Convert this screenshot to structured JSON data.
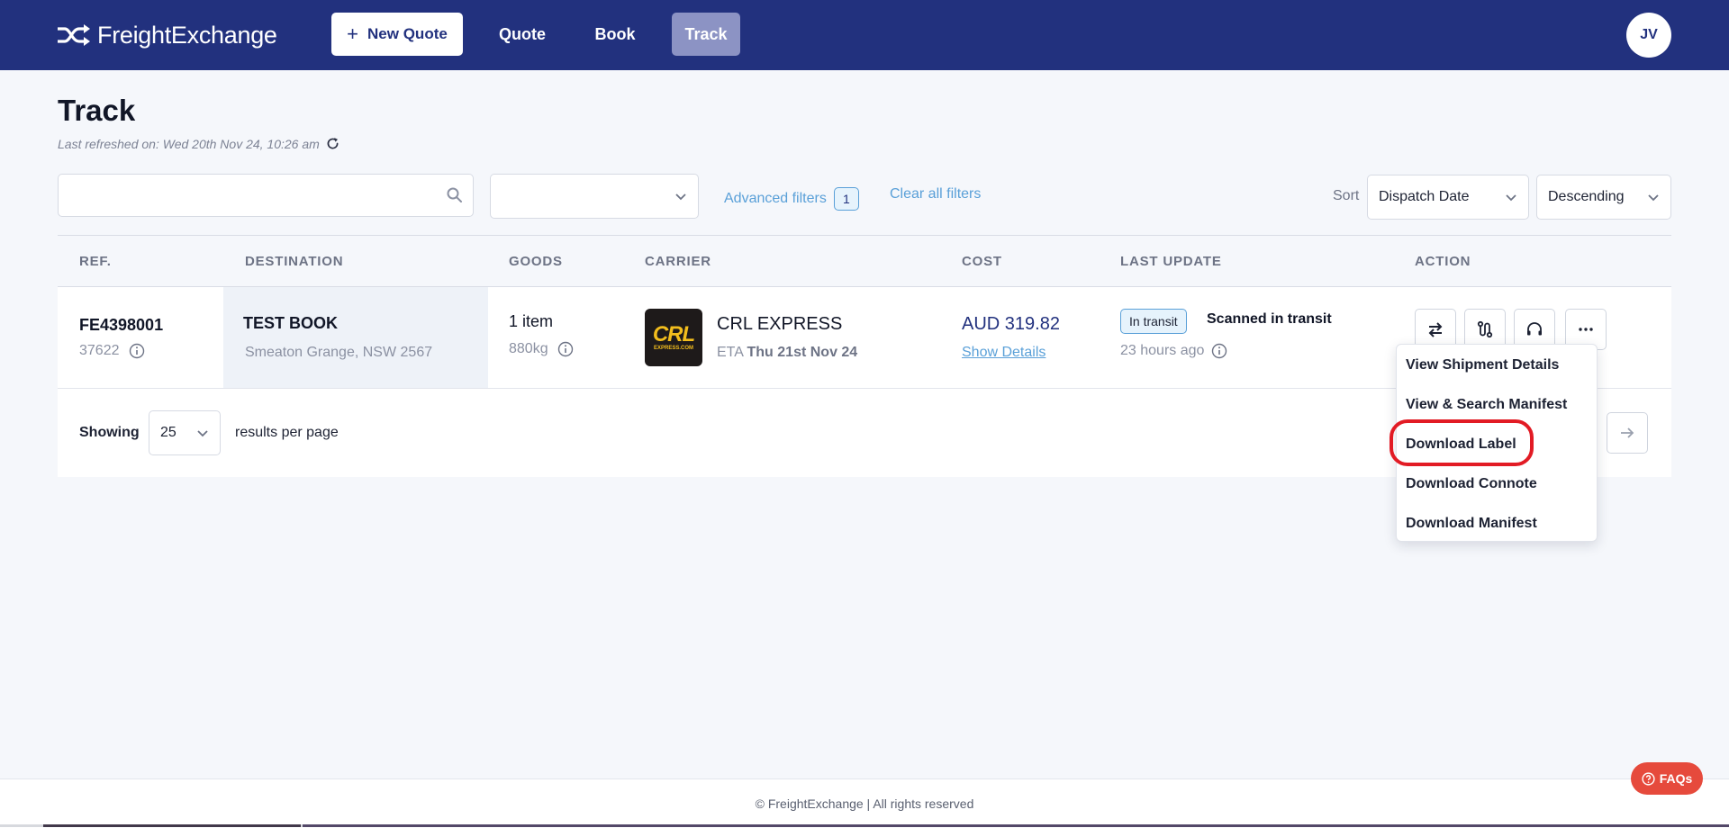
{
  "brand": {
    "name": "FreightExchange"
  },
  "header": {
    "new_quote": "New Quote",
    "nav": [
      "Quote",
      "Book",
      "Track"
    ],
    "avatar_initials": "JV"
  },
  "page": {
    "title": "Track",
    "last_refreshed": "Last refreshed on: Wed 20th Nov 24, 10:26 am"
  },
  "filters": {
    "search_value": "",
    "status_value": "",
    "advanced_label": "Advanced filters",
    "advanced_count": "1",
    "clear_label": "Clear all filters",
    "sort_label": "Sort",
    "sort_by": "Dispatch Date",
    "sort_order": "Descending"
  },
  "table": {
    "columns": [
      "REF.",
      "DESTINATION",
      "GOODS",
      "CARRIER",
      "COST",
      "LAST UPDATE",
      "ACTION"
    ],
    "rows": [
      {
        "ref": "FE4398001",
        "ref_sub": "37622",
        "dest_name": "TEST BOOK",
        "dest_addr": "Smeaton Grange, NSW 2567",
        "goods_qty": "1 item",
        "goods_weight": "880kg",
        "carrier_logo_text": "CRL",
        "carrier_logo_sub": "EXPRESS.COM",
        "carrier_name": "CRL EXPRESS",
        "eta_label": "ETA",
        "eta_date": "Thu 21st Nov 24",
        "cost": "AUD 319.82",
        "cost_link": "Show Details",
        "status_badge": "In transit",
        "status_text": "Scanned in transit",
        "updated_ago": "23 hours ago"
      }
    ]
  },
  "pagination": {
    "showing_label": "Showing",
    "per_page": "25",
    "per_page_label": "results per page"
  },
  "action_menu": {
    "items": [
      "View Shipment Details",
      "View & Search Manifest",
      "Download Label",
      "Download Connote",
      "Download Manifest"
    ]
  },
  "footer": {
    "copyright": "© FreightExchange | All rights reserved",
    "faq": "FAQs"
  },
  "colors": {
    "header_bg": "#22317e",
    "active_nav": "#8c93c4",
    "link": "#5aa0d8",
    "highlight": "#e21b24",
    "faq_bg": "#e64a3c"
  }
}
